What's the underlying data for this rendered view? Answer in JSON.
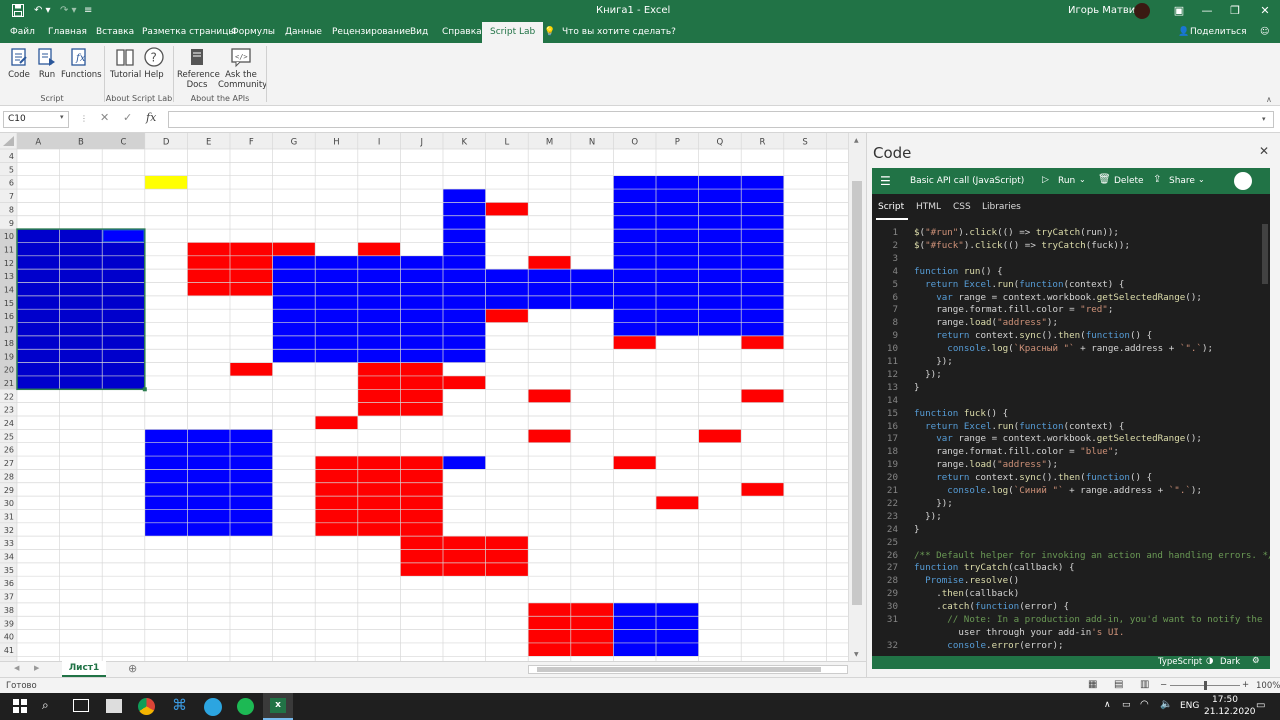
{
  "window": {
    "title": "Книга1  -  Excel",
    "user": "Игорь Матвиюк",
    "share": "Поделиться",
    "tell_me": "Что вы хотите сделать?"
  },
  "ribbon_tabs": [
    "Файл",
    "Главная",
    "Вставка",
    "Разметка страницы",
    "Формулы",
    "Данные",
    "Рецензирование",
    "Вид",
    "Справка",
    "Script Lab"
  ],
  "ribbon": {
    "buttons": [
      "Code",
      "Run",
      "Functions",
      "Tutorial",
      "Help",
      "Reference Docs",
      "Ask the Community"
    ],
    "groups": [
      "Script",
      "About Script Lab",
      "About the APIs"
    ]
  },
  "formula_bar": {
    "name_box": "C10",
    "fx": "fx",
    "value": ""
  },
  "grid": {
    "columns": [
      "A",
      "B",
      "C",
      "D",
      "E",
      "F",
      "G",
      "H",
      "I",
      "J",
      "K",
      "L",
      "M",
      "N",
      "O",
      "P",
      "Q",
      "R",
      "S"
    ],
    "row_start": 4,
    "row_end": 41,
    "selected_cell": "C10",
    "fills": [
      {
        "c0": 3,
        "c1": 3,
        "r0": 6,
        "r1": 6,
        "color": "#ffff00"
      },
      {
        "c0": 0,
        "c1": 2,
        "r0": 10,
        "r1": 21,
        "color": "#0000cc"
      },
      {
        "c0": 2,
        "c1": 2,
        "r0": 10,
        "r1": 10,
        "color": "#0000ff"
      },
      {
        "c0": 4,
        "c1": 6,
        "r0": 11,
        "r1": 11,
        "color": "#ff0000"
      },
      {
        "c0": 4,
        "c1": 5,
        "r0": 12,
        "r1": 14,
        "color": "#ff0000"
      },
      {
        "c0": 8,
        "c1": 8,
        "r0": 11,
        "r1": 11,
        "color": "#ff0000"
      },
      {
        "c0": 10,
        "c1": 10,
        "r0": 7,
        "r1": 11,
        "color": "#0000ff"
      },
      {
        "c0": 11,
        "c1": 11,
        "r0": 8,
        "r1": 8,
        "color": "#ff0000"
      },
      {
        "c0": 12,
        "c1": 12,
        "r0": 12,
        "r1": 12,
        "color": "#ff0000"
      },
      {
        "c0": 14,
        "c1": 17,
        "r0": 6,
        "r1": 17,
        "color": "#0000ff"
      },
      {
        "c0": 6,
        "c1": 10,
        "r0": 12,
        "r1": 19,
        "color": "#0000ff"
      },
      {
        "c0": 11,
        "c1": 13,
        "r0": 13,
        "r1": 15,
        "color": "#0000ff"
      },
      {
        "c0": 11,
        "c1": 11,
        "r0": 16,
        "r1": 16,
        "color": "#ff0000"
      },
      {
        "c0": 14,
        "c1": 14,
        "r0": 18,
        "r1": 18,
        "color": "#ff0000"
      },
      {
        "c0": 17,
        "c1": 17,
        "r0": 18,
        "r1": 18,
        "color": "#ff0000"
      },
      {
        "c0": 5,
        "c1": 5,
        "r0": 20,
        "r1": 20,
        "color": "#ff0000"
      },
      {
        "c0": 8,
        "c1": 9,
        "r0": 20,
        "r1": 23,
        "color": "#ff0000"
      },
      {
        "c0": 10,
        "c1": 10,
        "r0": 21,
        "r1": 21,
        "color": "#ff0000"
      },
      {
        "c0": 12,
        "c1": 12,
        "r0": 22,
        "r1": 22,
        "color": "#ff0000"
      },
      {
        "c0": 17,
        "c1": 17,
        "r0": 22,
        "r1": 22,
        "color": "#ff0000"
      },
      {
        "c0": 7,
        "c1": 7,
        "r0": 24,
        "r1": 24,
        "color": "#ff0000"
      },
      {
        "c0": 12,
        "c1": 12,
        "r0": 25,
        "r1": 25,
        "color": "#ff0000"
      },
      {
        "c0": 16,
        "c1": 16,
        "r0": 25,
        "r1": 25,
        "color": "#ff0000"
      },
      {
        "c0": 3,
        "c1": 5,
        "r0": 25,
        "r1": 32,
        "color": "#0000ff"
      },
      {
        "c0": 7,
        "c1": 9,
        "r0": 27,
        "r1": 32,
        "color": "#ff0000"
      },
      {
        "c0": 10,
        "c1": 10,
        "r0": 27,
        "r1": 27,
        "color": "#0000ff"
      },
      {
        "c0": 14,
        "c1": 14,
        "r0": 27,
        "r1": 27,
        "color": "#ff0000"
      },
      {
        "c0": 17,
        "c1": 17,
        "r0": 29,
        "r1": 29,
        "color": "#ff0000"
      },
      {
        "c0": 15,
        "c1": 15,
        "r0": 30,
        "r1": 30,
        "color": "#ff0000"
      },
      {
        "c0": 9,
        "c1": 11,
        "r0": 33,
        "r1": 35,
        "color": "#ff0000"
      },
      {
        "c0": 12,
        "c1": 13,
        "r0": 38,
        "r1": 41,
        "color": "#ff0000"
      },
      {
        "c0": 14,
        "c1": 15,
        "r0": 38,
        "r1": 41,
        "color": "#0000ff"
      }
    ]
  },
  "sheet_tabs": [
    "Лист1"
  ],
  "status": {
    "ready": "Готово",
    "zoom": "100%"
  },
  "taskbar": {
    "lang": "ENG",
    "time": "17:50",
    "date": "21.12.2020"
  },
  "script_lab": {
    "pane_title": "Code",
    "snippet_name": "Basic API call (JavaScript)",
    "actions": [
      "Run",
      "Delete",
      "Share"
    ],
    "tabs": [
      "Script",
      "HTML",
      "CSS",
      "Libraries"
    ],
    "footer": [
      "TypeScript",
      "Dark"
    ],
    "code": [
      {
        "n": "1",
        "t": "$(\"#run\").click(() => tryCatch(run));"
      },
      {
        "n": "2",
        "t": "$(\"#fuck\").click(() => tryCatch(fuck));"
      },
      {
        "n": "3",
        "t": ""
      },
      {
        "n": "4",
        "t": "function run() {"
      },
      {
        "n": "5",
        "t": "  return Excel.run(function(context) {"
      },
      {
        "n": "6",
        "t": "    var range = context.workbook.getSelectedRange();"
      },
      {
        "n": "7",
        "t": "    range.format.fill.color = \"red\";"
      },
      {
        "n": "8",
        "t": "    range.load(\"address\");"
      },
      {
        "n": "9",
        "t": "    return context.sync().then(function() {"
      },
      {
        "n": "10",
        "t": "      console.log(`Красный \"` + range.address + `\".`);"
      },
      {
        "n": "11",
        "t": "    });"
      },
      {
        "n": "12",
        "t": "  });"
      },
      {
        "n": "13",
        "t": "}"
      },
      {
        "n": "14",
        "t": ""
      },
      {
        "n": "15",
        "t": "function fuck() {"
      },
      {
        "n": "16",
        "t": "  return Excel.run(function(context) {"
      },
      {
        "n": "17",
        "t": "    var range = context.workbook.getSelectedRange();"
      },
      {
        "n": "18",
        "t": "    range.format.fill.color = \"blue\";"
      },
      {
        "n": "19",
        "t": "    range.load(\"address\");"
      },
      {
        "n": "20",
        "t": "    return context.sync().then(function() {"
      },
      {
        "n": "21",
        "t": "      console.log(`Синий \"` + range.address + `\".`);"
      },
      {
        "n": "22",
        "t": "    });"
      },
      {
        "n": "23",
        "t": "  });"
      },
      {
        "n": "24",
        "t": "}"
      },
      {
        "n": "25",
        "t": ""
      },
      {
        "n": "26",
        "t": "/** Default helper for invoking an action and handling errors. */"
      },
      {
        "n": "27",
        "t": "function tryCatch(callback) {"
      },
      {
        "n": "28",
        "t": "  Promise.resolve()"
      },
      {
        "n": "29",
        "t": "    .then(callback)"
      },
      {
        "n": "30",
        "t": "    .catch(function(error) {"
      },
      {
        "n": "31",
        "t": "      // Note: In a production add-in, you'd want to notify the"
      },
      {
        "n": "",
        "t": "        user through your add-in's UI."
      },
      {
        "n": "32",
        "t": "      console.error(error);"
      }
    ]
  },
  "colors": {
    "excel_green": "#217346",
    "editor_bg": "#1e1e1e"
  }
}
